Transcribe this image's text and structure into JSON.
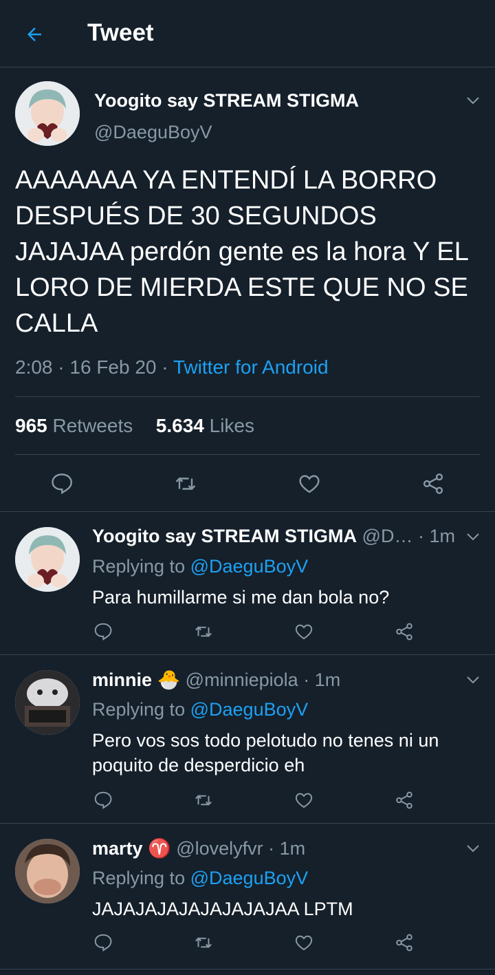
{
  "header": {
    "title": "Tweet"
  },
  "main_tweet": {
    "name": "Yoogito say STREAM STIGMA",
    "handle": "@DaeguBoyV",
    "text": "AAAAAAA YA ENTENDÍ LA BORRO DESPUÉS DE 30 SEGUNDOS JAJAJAA perdón gente es la hora Y EL LORO DE MIERDA ESTE QUE NO SE CALLA",
    "time": "2:08",
    "date": "16 Feb 20",
    "source": "Twitter for Android",
    "retweets_count": "965",
    "retweets_label": "Retweets",
    "likes_count": "5.634",
    "likes_label": "Likes"
  },
  "replies": [
    {
      "name": "Yoogito say STREAM STIGMA",
      "emoji": "",
      "handle": "@D…",
      "time": "· 1m",
      "replying_label": "Replying to",
      "replying_to": "@DaeguBoyV",
      "text": "Para humillarme si me dan bola no?"
    },
    {
      "name": "minnie",
      "emoji": "🐣",
      "handle": "@minniepiola",
      "time": "· 1m",
      "replying_label": "Replying to",
      "replying_to": "@DaeguBoyV",
      "text": "Pero vos sos todo pelotudo no tenes ni un poquito de desperdicio eh"
    },
    {
      "name": "marty",
      "emoji": "♈",
      "handle": "@lovelyfvr",
      "time": "· 1m",
      "replying_label": "Replying to",
      "replying_to": "@DaeguBoyV",
      "text": "JAJAJAJAJAJAJAJAJAA LPTM"
    }
  ],
  "colors": {
    "background": "#15202b",
    "accent": "#1da1f2",
    "muted": "#8899a6",
    "divider": "#38444d"
  },
  "icons": [
    "back-arrow-icon",
    "chevron-down-icon",
    "reply-icon",
    "retweet-icon",
    "like-icon",
    "share-icon"
  ]
}
